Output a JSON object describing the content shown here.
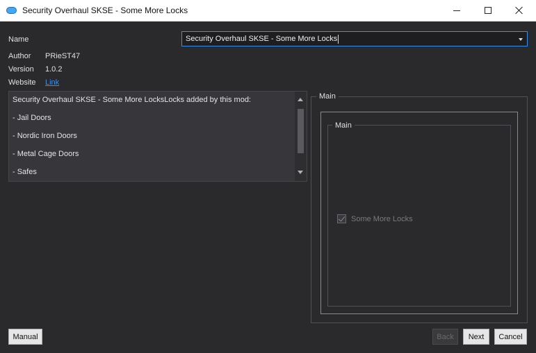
{
  "window": {
    "title": "Security Overhaul SKSE - Some More Locks"
  },
  "info": {
    "name_label": "Name",
    "name_value": "Security Overhaul SKSE - Some More Locks",
    "author_label": "Author",
    "author_value": "PRieST47",
    "version_label": "Version",
    "version_value": "1.0.2",
    "website_label": "Website",
    "website_value": "Link"
  },
  "description": {
    "lines": [
      "Security Overhaul SKSE - Some More LocksLocks added by this mod:",
      "- Jail Doors",
      "- Nordic Iron Doors",
      "- Metal Cage Doors",
      "- Safes"
    ]
  },
  "options": {
    "outer_group_title": "Main",
    "inner_group_title": "Main",
    "checkbox_label": "Some More Locks",
    "checkbox_checked": true
  },
  "buttons": {
    "manual": "Manual",
    "back": "Back",
    "next": "Next",
    "cancel": "Cancel"
  },
  "colors": {
    "accent": "#3d8ee9",
    "background": "#2a2a2d"
  }
}
